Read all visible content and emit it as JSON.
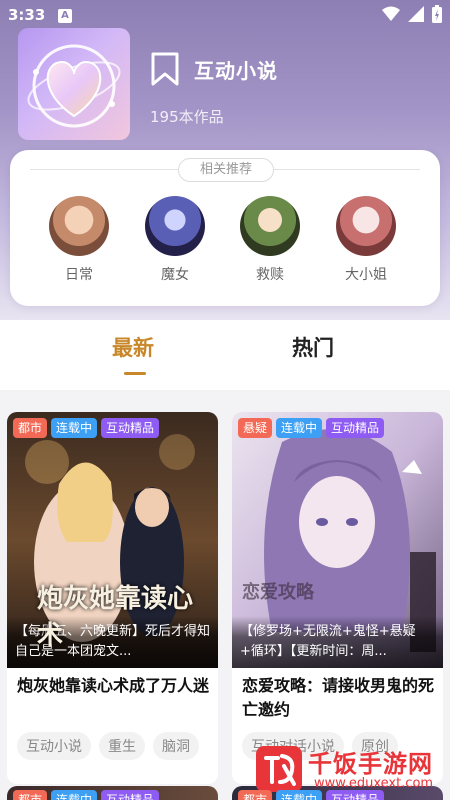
{
  "status": {
    "time": "3:33",
    "badge": "A"
  },
  "header": {
    "title": "互动小说",
    "count": "195本作品"
  },
  "recommend": {
    "title": "相关推荐",
    "items": [
      {
        "label": "日常"
      },
      {
        "label": "魔女"
      },
      {
        "label": "救赎"
      },
      {
        "label": "大小姐"
      }
    ]
  },
  "tabs": {
    "latest": "最新",
    "hot": "热门"
  },
  "books": [
    {
      "tags": [
        "都市",
        "连载中",
        "互动精品"
      ],
      "cover_text": "炮灰她靠读心术",
      "desc": "【每周五、六晚更新】死后才得知自己是一本团宠文...",
      "name": "炮灰她靠读心术成了万人迷",
      "chips": [
        "互动小说",
        "重生",
        "脑洞"
      ]
    },
    {
      "tags": [
        "悬疑",
        "连载中",
        "互动精品"
      ],
      "cover_text": "恋爱攻略",
      "desc": "【修罗场+无限流+鬼怪+悬疑+循环】【更新时间：周...",
      "name": "恋爱攻略：请接收男鬼的死亡邀约",
      "chips": [
        "互动对话小说",
        "原创"
      ]
    }
  ],
  "peek_tags": [
    [
      "都市",
      "连载中",
      "互动精品"
    ],
    [
      "都市",
      "连载中",
      "互动精品"
    ]
  ],
  "watermark": {
    "brand": "千饭手游网",
    "url": "www.eduxext.com"
  }
}
